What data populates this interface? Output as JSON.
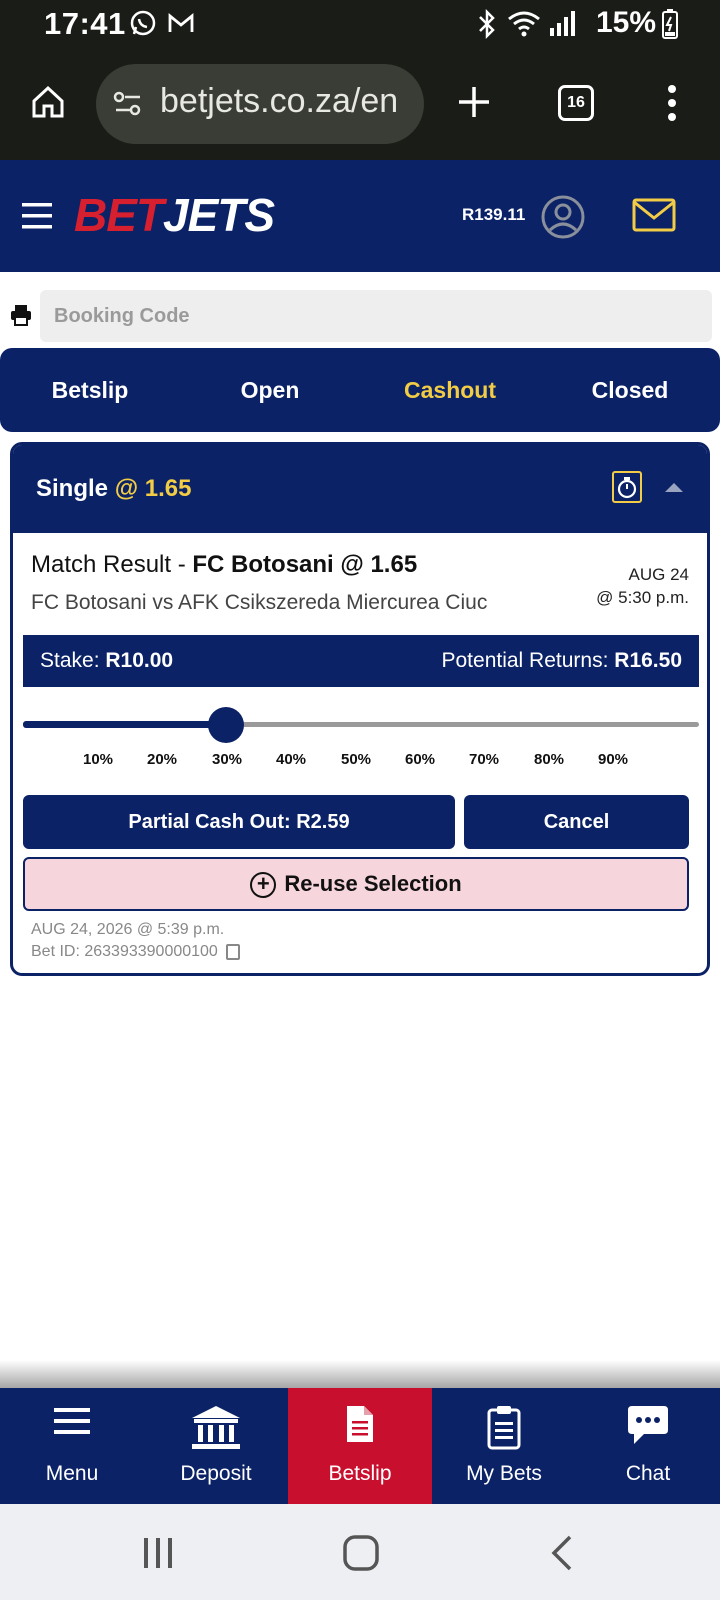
{
  "status_bar": {
    "time": "17:41",
    "battery": "15%",
    "icons": [
      "whatsapp-icon",
      "gmail-icon",
      "bluetooth-icon",
      "wifi-icon",
      "signal-icon",
      "battery-charging-icon"
    ]
  },
  "browser": {
    "url": "betjets.co.za/en",
    "tab_count": "16"
  },
  "header": {
    "logo_part1": "BET",
    "logo_part2": "JETS",
    "balance": "R139.11"
  },
  "booking": {
    "placeholder": "Booking Code"
  },
  "tabs": [
    {
      "label": "Betslip",
      "active": false
    },
    {
      "label": "Open",
      "active": false
    },
    {
      "label": "Cashout",
      "active": true
    },
    {
      "label": "Closed",
      "active": false
    }
  ],
  "bet": {
    "type": "Single",
    "odds_label": "@ 1.65",
    "market": "Match Result - ",
    "selection": "FC Botosani @ 1.65",
    "teams": "FC Botosani vs AFK Csikszereda Miercurea Ciuc",
    "match_date": "AUG 24",
    "match_time": "@ 5:30 p.m.",
    "stake_label": "Stake:",
    "stake_value": "R10.00",
    "returns_label": "Potential Returns:",
    "returns_value": "R16.50",
    "slider_value": 0.3,
    "slider_ticks": [
      "10%",
      "20%",
      "30%",
      "40%",
      "50%",
      "60%",
      "70%",
      "80%",
      "90%"
    ],
    "partial_cashout_label": "Partial Cash Out: R2.59",
    "cancel_label": "Cancel",
    "reuse_label": "Re-use Selection",
    "placed": "AUG 24, 2026 @ 5:39 p.m.",
    "bet_id": "Bet ID: 263393390000100"
  },
  "bottom_nav": [
    {
      "label": "Menu",
      "icon": "menu-icon",
      "active": false
    },
    {
      "label": "Deposit",
      "icon": "bank-icon",
      "active": false
    },
    {
      "label": "Betslip",
      "icon": "document-icon",
      "active": true
    },
    {
      "label": "My Bets",
      "icon": "clipboard-icon",
      "active": false
    },
    {
      "label": "Chat",
      "icon": "chat-bubble-icon",
      "active": false
    }
  ],
  "colors": {
    "brand_navy": "#0b2266",
    "accent_yellow": "#f3cc45",
    "brand_red": "#c8102e"
  }
}
